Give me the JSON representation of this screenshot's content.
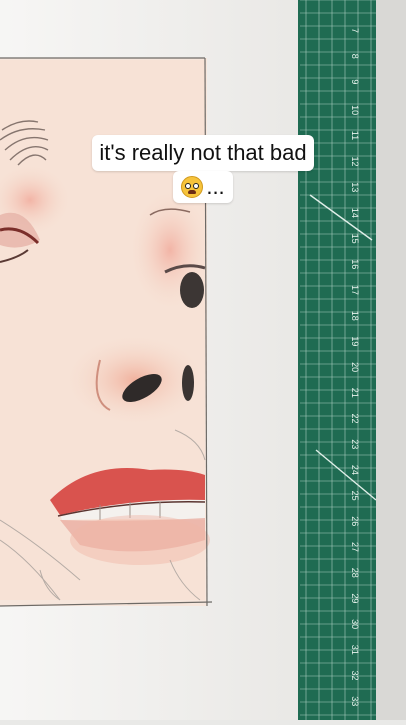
{
  "caption": {
    "line1": "it's really not that bad",
    "line2_suffix": "...",
    "emoji_icon": "grimacing-face-emoji"
  },
  "ruler": {
    "numbers": [
      "7",
      "8",
      "9",
      "10",
      "11",
      "12",
      "13",
      "14",
      "15",
      "16",
      "17",
      "18",
      "19",
      "20",
      "21",
      "22",
      "23",
      "24",
      "25",
      "26",
      "27",
      "28",
      "29",
      "30",
      "31",
      "32",
      "33"
    ],
    "color": "#1f6b52"
  },
  "colors": {
    "paper": "#f4efe9",
    "skin": "#f6dccd",
    "lips": "#d9534e",
    "table": "#e9e9e7"
  }
}
